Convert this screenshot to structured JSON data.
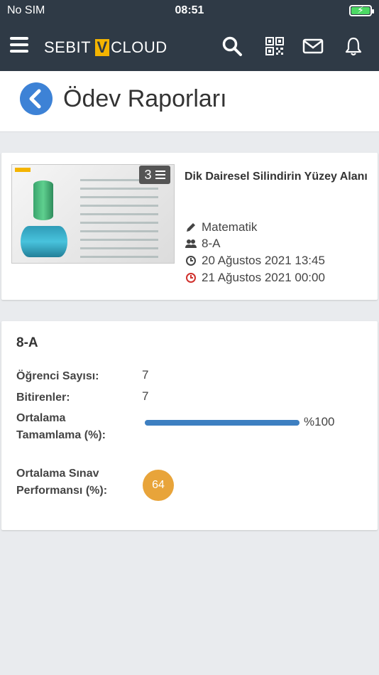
{
  "status_bar": {
    "carrier": "No SIM",
    "time": "08:51"
  },
  "navbar": {
    "brand_left": "SEBIT",
    "brand_mark": "V",
    "brand_right": "CLOUD",
    "icons": [
      "menu-icon",
      "search-icon",
      "qr-code-icon",
      "mail-icon",
      "bell-icon"
    ]
  },
  "header": {
    "title": "Ödev Raporları"
  },
  "assignment": {
    "thumbnail_count": "3",
    "title": "Dik Dairesel Silindirin Yüzey Alanı",
    "subject": "Matematik",
    "class": "8-A",
    "start_date": "20 Ağustos 2021 13:45",
    "end_date": "21 Ağustos 2021 00:00"
  },
  "report": {
    "class_name": "8-A",
    "student_count_label": "Öğrenci Sayısı:",
    "student_count": "7",
    "finished_label": "Bitirenler:",
    "finished": "7",
    "avg_completion_label": "Ortalama Tamamlama (%):",
    "avg_completion_text": "%100",
    "avg_completion_value": 100,
    "avg_exam_label": "Ortalama Sınav Performansı (%):",
    "avg_exam": "64"
  },
  "colors": {
    "nav_bg": "#2f3a46",
    "brand_accent": "#f4b400",
    "back_button": "#3d82d6",
    "progress": "#3d7fc1",
    "score_badge": "#e8a43a",
    "end_date_icon": "#d0312d"
  }
}
